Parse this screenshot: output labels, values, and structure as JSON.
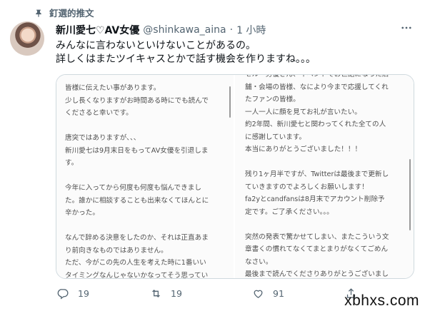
{
  "pinned_label": "釘選的推文",
  "tweet": {
    "display_name": "新川愛七♡AV女優",
    "handle": "@shinkawa_aina",
    "separator": "·",
    "time": "1 小時",
    "text_line1": "みんなに言わないといけないことがあるの。",
    "text_line2": "詳しくはまたツイキャスとかで話す機会を作りますね。。。"
  },
  "media": {
    "left_panel_text": "皆様に伝えたい事があります。\n少し長くなりますがお時間ある時にでも読んで\nくださると幸いです。\n\n唐突ではありますが、、、\n新川愛七は9月末日をもってAV女優を引退しま\nす。\n\n今年に入ってから何度も何度も悩んできまし\nた。誰かに相談することも出来なくてほんとに\n辛かった。\n\nなんで辞める決意をしたのか、それは正直あま\nり前向きなものではありません。\nただ、今がこの先の人生を考えた時に1番いい\nタイミングなんじゃないかなってそう思ってい\nます。。。",
    "right_panel_text": "セル・労優さん、イベントでお世話になった店\n舗・会場の皆様、なにより今まで応援してくれ\nたファンの皆様。\n一人一人に顔を見てお礼が言いたい。\n約2年間、新川愛七と関わってくれた全ての人\nに感謝しています。\n本当にありがとうございました！！！\n\n残り1ヶ月半ですが、Twitterは最後まで更新し\nていきますのでよろしくお願いします！\nfa2yとcandfansは8月末でアカウント削除予\n定です。ご了承ください。。。\n\n突然の発表で驚かせてしまい、またこういう文\n章書くの慣れてなくてまとまりがなくてごめん\nなさい。\n最後まで読んでくださりありがとうございまし\nた。"
  },
  "actions": {
    "reply_count": "19",
    "retweet_count": "19",
    "like_count": "91"
  },
  "icons": {
    "pin": "pin-icon",
    "more": "more-icon",
    "reply": "reply-icon",
    "retweet": "retweet-icon",
    "like": "heart-icon",
    "share": "share-icon"
  },
  "colors": {
    "secondary_text": "#536471",
    "border": "#cfd9de"
  },
  "watermark": "xbhxs.com"
}
